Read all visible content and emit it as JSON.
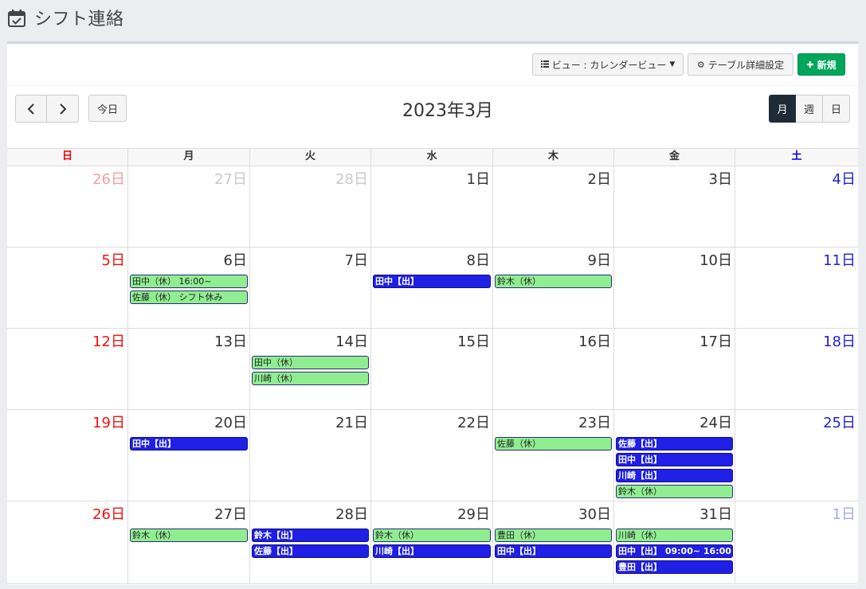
{
  "page": {
    "title": "シフト連絡",
    "title_icon": "calendar-check-icon"
  },
  "toolbar": {
    "view_label": "ビュー : カレンダービュー",
    "settings_label": "テーブル詳細設定",
    "new_label": "新規"
  },
  "calendar": {
    "today_label": "今日",
    "title": "2023年3月",
    "view_buttons": [
      "月",
      "週",
      "日"
    ],
    "active_view": "月",
    "weekdays": [
      "日",
      "月",
      "火",
      "水",
      "木",
      "金",
      "土"
    ],
    "weeks": [
      [
        {
          "label": "26日",
          "other": true,
          "events": []
        },
        {
          "label": "27日",
          "other": true,
          "events": []
        },
        {
          "label": "28日",
          "other": true,
          "events": []
        },
        {
          "label": "1日",
          "other": false,
          "events": []
        },
        {
          "label": "2日",
          "other": false,
          "events": []
        },
        {
          "label": "3日",
          "other": false,
          "events": []
        },
        {
          "label": "4日",
          "other": false,
          "events": []
        }
      ],
      [
        {
          "label": "5日",
          "other": false,
          "events": []
        },
        {
          "label": "6日",
          "other": false,
          "events": [
            {
              "text": "田中（休） 16:00~",
              "type": "off"
            },
            {
              "text": "佐藤（休） シフト休み",
              "type": "off"
            }
          ]
        },
        {
          "label": "7日",
          "other": false,
          "events": []
        },
        {
          "label": "8日",
          "other": false,
          "events": [
            {
              "text": "田中【出】",
              "type": "on"
            }
          ]
        },
        {
          "label": "9日",
          "other": false,
          "events": [
            {
              "text": "鈴木（休）",
              "type": "off"
            }
          ]
        },
        {
          "label": "10日",
          "other": false,
          "events": []
        },
        {
          "label": "11日",
          "other": false,
          "events": []
        }
      ],
      [
        {
          "label": "12日",
          "other": false,
          "events": []
        },
        {
          "label": "13日",
          "other": false,
          "events": []
        },
        {
          "label": "14日",
          "other": false,
          "events": [
            {
              "text": "田中（休）",
              "type": "off"
            },
            {
              "text": "川崎（休）",
              "type": "off"
            }
          ]
        },
        {
          "label": "15日",
          "other": false,
          "events": []
        },
        {
          "label": "16日",
          "other": false,
          "events": []
        },
        {
          "label": "17日",
          "other": false,
          "events": []
        },
        {
          "label": "18日",
          "other": false,
          "events": []
        }
      ],
      [
        {
          "label": "19日",
          "other": false,
          "events": []
        },
        {
          "label": "20日",
          "other": false,
          "events": [
            {
              "text": "田中【出】",
              "type": "on"
            }
          ]
        },
        {
          "label": "21日",
          "other": false,
          "events": []
        },
        {
          "label": "22日",
          "other": false,
          "events": []
        },
        {
          "label": "23日",
          "other": false,
          "events": [
            {
              "text": "佐藤（休）",
              "type": "off"
            }
          ]
        },
        {
          "label": "24日",
          "other": false,
          "events": [
            {
              "text": "佐藤【出】",
              "type": "on"
            },
            {
              "text": "田中【出】",
              "type": "on"
            },
            {
              "text": "川崎【出】",
              "type": "on"
            },
            {
              "text": "鈴木（休）",
              "type": "off"
            }
          ]
        },
        {
          "label": "25日",
          "other": false,
          "events": []
        }
      ],
      [
        {
          "label": "26日",
          "other": false,
          "events": []
        },
        {
          "label": "27日",
          "other": false,
          "events": [
            {
              "text": "鈴木（休）",
              "type": "off"
            }
          ]
        },
        {
          "label": "28日",
          "other": false,
          "events": [
            {
              "text": "鈴木【出】",
              "type": "on"
            },
            {
              "text": "佐藤【出】",
              "type": "on"
            }
          ]
        },
        {
          "label": "29日",
          "other": false,
          "events": [
            {
              "text": "鈴木（休）",
              "type": "off"
            },
            {
              "text": "川崎【出】",
              "type": "on"
            }
          ]
        },
        {
          "label": "30日",
          "other": false,
          "events": [
            {
              "text": "豊田（休）",
              "type": "off"
            },
            {
              "text": "田中【出】",
              "type": "on"
            }
          ]
        },
        {
          "label": "31日",
          "other": false,
          "events": [
            {
              "text": "川崎（休）",
              "type": "off"
            },
            {
              "text": "田中【出】 09:00~ 16:00",
              "type": "on"
            },
            {
              "text": "豊田【出】",
              "type": "on"
            }
          ]
        },
        {
          "label": "1日",
          "other": true,
          "events": []
        }
      ]
    ]
  }
}
